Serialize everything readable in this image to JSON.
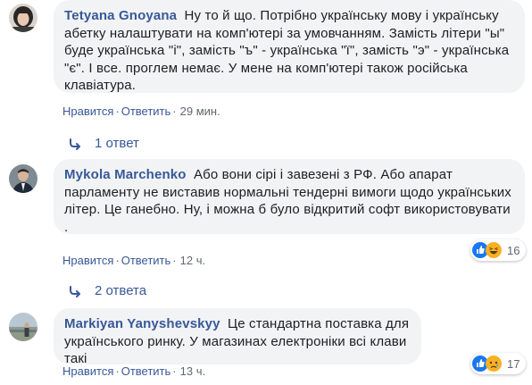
{
  "comments": [
    {
      "author": "Tetyana Gnoyana",
      "text": "Ну то й що. Потрібно українську мову і українську абетку налаштувати на комп'ютері за умовчанням. Замість літери \"ы\" буде українська \"і\", замість \"ъ\" - українська \"ї\", замість \"э\" - українська \"є\". І все. проглем немає. У мене на комп'ютері також російська клавіатура.",
      "like_label": "Нравится",
      "reply_label": "Ответить",
      "time": "29 мин.",
      "replies_label": "1 ответ"
    },
    {
      "author": "Mykola Marchenko",
      "text": "Або вони сірі і завезені з РФ. Або апарат парламенту не виставив нормальні тендерні вимоги щодо українських літер. Це ганебно. Ну, і можна б було відкритий софт використовувати .",
      "like_label": "Нравится",
      "reply_label": "Ответить",
      "time": "12 ч.",
      "replies_label": "2 ответа",
      "reactions": {
        "count": "16",
        "icons": [
          "like-icon",
          "haha-icon"
        ]
      }
    },
    {
      "author": "Markiyan Yanyshevskyy",
      "text": "Це стандартна поставка для українського ринку. У магазинах електроніки всі клави такі",
      "like_label": "Нравится",
      "reply_label": "Ответить",
      "time": "13 ч.",
      "reactions": {
        "count": "17",
        "icons": [
          "like-icon",
          "sad-icon"
        ]
      }
    }
  ],
  "separator": "·",
  "colors": {
    "link": "#385898",
    "bubble": "#f2f3f5",
    "meta": "#606770",
    "like": "#1877f2",
    "emoji_yellow": "#f7b125"
  }
}
